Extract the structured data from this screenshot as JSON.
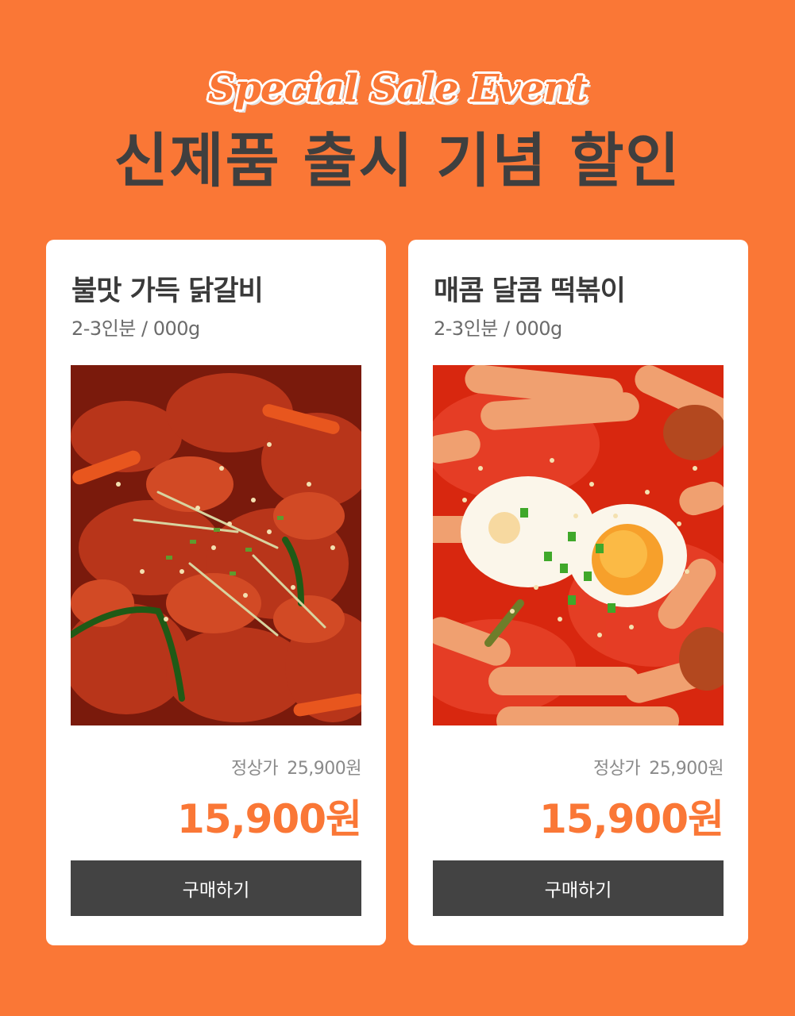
{
  "header": {
    "event_tag": "Special Sale Event",
    "headline": "신제품 출시 기념 할인"
  },
  "products": [
    {
      "name": "불맛 가득 닭갈비",
      "portion": "2-3인분 / 000g",
      "image_desc_icon": "dakgalbi-photo",
      "regular_label": "정상가",
      "regular_price": "25,900원",
      "sale_price": "15,900원",
      "buy_label": "구매하기"
    },
    {
      "name": "매콤 달콤 떡볶이",
      "portion": "2-3인분 / 000g",
      "image_desc_icon": "tteokbokki-photo",
      "regular_label": "정상가",
      "regular_price": "25,900원",
      "sale_price": "15,900원",
      "buy_label": "구매하기"
    }
  ],
  "colors": {
    "background": "#FA7736",
    "accent": "#FA7736",
    "headline": "#3F3F3F",
    "button": "#434343"
  }
}
